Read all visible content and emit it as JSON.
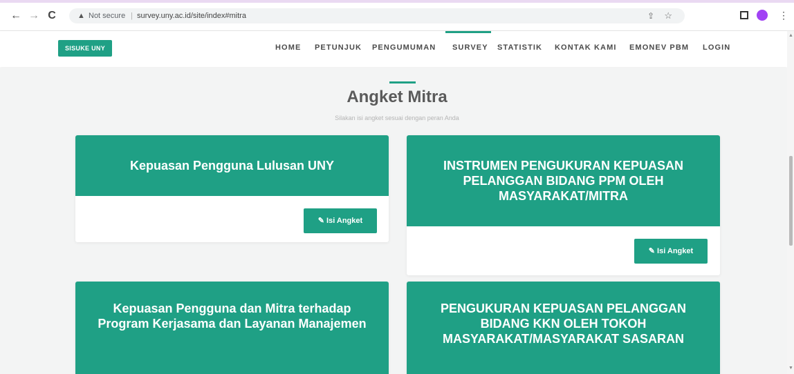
{
  "browser": {
    "back_icon": "←",
    "forward_icon": "→",
    "reload_icon": "C",
    "security_icon": "▲",
    "security_label": "Not secure",
    "separator": "|",
    "url": "survey.uny.ac.id/site/index#mitra",
    "share_icon": "⇪",
    "star_icon": "☆",
    "menu_icon": "⋮"
  },
  "header": {
    "logo": "SISUKE UNY",
    "nav": {
      "home": "HOME",
      "petunjuk": "PETUNJUK",
      "pengumuman": "PENGUMUMAN",
      "survey": "SURVEY",
      "statistik": "STATISTIK",
      "kontak": "KONTAK KAMI",
      "emonev": "EMONEV PBM",
      "login": "LOGIN"
    },
    "active": "SURVEY"
  },
  "main": {
    "title": "Angket Mitra",
    "subtitle": "Silakan isi angket sesuai dengan peran Anda",
    "cards": [
      {
        "title": "Kepuasan Pengguna Lulusan UNY",
        "button": "Isi Angket"
      },
      {
        "title": "INSTRUMEN PENGUKURAN KEPUASAN PELANGGAN BIDANG PPM OLEH MASYARAKAT/MITRA",
        "button": "Isi Angket"
      },
      {
        "title": "Kepuasan Pengguna dan Mitra terhadap Program Kerjasama dan Layanan Manajemen"
      },
      {
        "title": "PENGUKURAN KEPUASAN PELANGGAN BIDANG KKN OLEH TOKOH MASYARAKAT/MASYARAKAT SASARAN"
      }
    ],
    "button_icon": "✎"
  },
  "colors": {
    "accent": "#1fa085",
    "page_bg": "#f3f4f4",
    "title": "#5a5a5a"
  }
}
